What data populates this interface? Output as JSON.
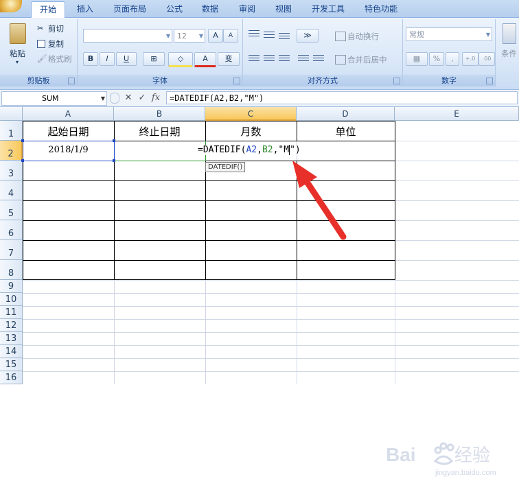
{
  "tabs": [
    "开始",
    "插入",
    "页面布局",
    "公式",
    "数据",
    "审阅",
    "视图",
    "开发工具",
    "特色功能"
  ],
  "ribbon": {
    "clipboard": {
      "paste": "粘贴",
      "cut": "剪切",
      "copy": "复制",
      "format_painter": "格式刷",
      "label": "剪贴板"
    },
    "font": {
      "font_size": "12",
      "bold": "B",
      "italic": "I",
      "underline": "U",
      "grow": "A",
      "shrink": "A",
      "phonetic": "变",
      "label": "字体"
    },
    "alignment": {
      "wrap_text": "自动换行",
      "merge_center": "合并后居中",
      "label": "对齐方式"
    },
    "number": {
      "format": "常规",
      "percent": "%",
      "comma": ",",
      "inc_decimal": "+.0",
      "dec_decimal": ".00",
      "label": "数字"
    },
    "styles": {
      "conditional": "条件"
    }
  },
  "formula_bar": {
    "name_box": "SUM",
    "cancel": "✕",
    "enter": "✓",
    "fx": "fx",
    "formula": "=DATEDIF(A2,B2,\"M\")"
  },
  "sheet": {
    "columns": [
      "A",
      "B",
      "C",
      "D",
      "E"
    ],
    "rows": [
      "1",
      "2",
      "3",
      "4",
      "5",
      "6",
      "7",
      "8",
      "9",
      "10",
      "11",
      "12",
      "13",
      "14",
      "15",
      "16"
    ],
    "headers": {
      "A1": "起始日期",
      "B1": "终止日期",
      "C1": "月数",
      "D1": "单位"
    },
    "A2": "2018/1/9",
    "edit_formula": {
      "prefix": "=DATEDIF(",
      "ref_a": "A2",
      "sep1": ",",
      "ref_b": "B2",
      "sep2": ",",
      "quote_open": "\"M",
      "suffix": "\")"
    },
    "tooltip": "DATEDIF()"
  },
  "watermark": {
    "text": "Baidu经验",
    "sub": "jingyan.baidu.com"
  },
  "colors": {
    "accent": "#15428b",
    "arrow": "#e8302a",
    "selection": "#1f47c4",
    "ref_b": "#2d8a2d"
  }
}
